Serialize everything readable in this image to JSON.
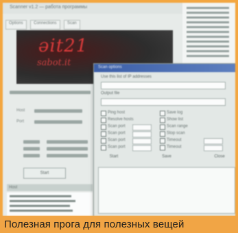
{
  "caption": "Полезная прога для полезных вещей",
  "screenshot": {
    "back_window_title": "Scanner v1.2 — работа программы",
    "back_tabs": [
      "Options",
      "Connections",
      "Scan"
    ],
    "logo_line1": "ǝit21",
    "logo_line2": "sabot.it",
    "field_labels": [
      "Host",
      "Port"
    ],
    "back_button": "Start",
    "dialog_title": "Scan options",
    "dialog_labels": [
      "Use this list of IP addresses",
      "Output file"
    ],
    "checkbox_labels": [
      "Ping host",
      "Resolve hosts",
      "Scan port",
      "Scan port",
      "Scan port",
      "Scan port",
      "Save log",
      "Show list",
      "Scan range",
      "Stop scan",
      "Timeout",
      "Timeout"
    ],
    "dialog_buttons": [
      "Start",
      "Save",
      "Close"
    ],
    "bottom_list_header": "Host"
  }
}
